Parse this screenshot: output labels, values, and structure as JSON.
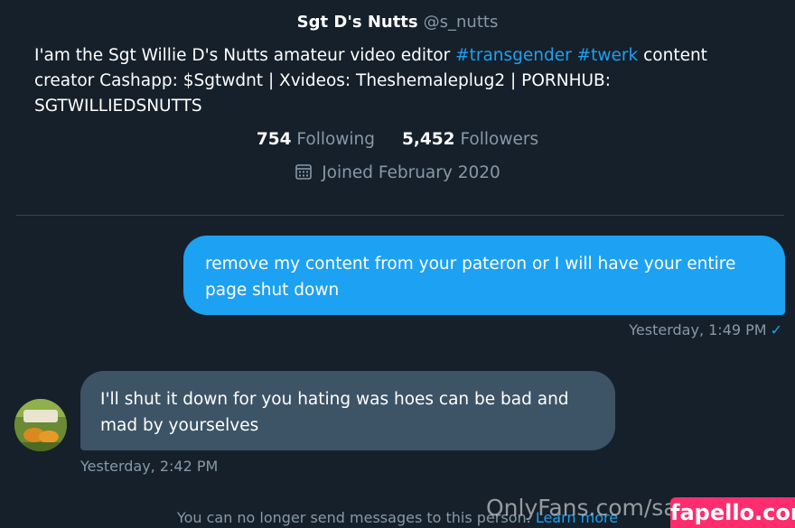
{
  "profile": {
    "name": "Sgt D's Nutts",
    "handle": "@s_nutts",
    "bio_part1": "I'am the Sgt Willie D's Nutts amateur video editor ",
    "hashtag1": "#transgender",
    "hashtag2": "#twerk",
    "bio_part2": " content creator Cashapp: $Sgtwdnt | Xvideos: Theshemaleplug2 | PORNHUB: SGTWILLIEDSNUTTS",
    "following_count": "754",
    "following_label": "Following",
    "followers_count": "5,452",
    "followers_label": "Followers",
    "joined": "Joined February 2020",
    "joined_icon": "calendar-icon"
  },
  "messages": [
    {
      "direction": "outgoing",
      "text": "remove my content from your pateron or I will have your entire page shut down",
      "timestamp": "Yesterday, 1:49 PM",
      "status": "✓"
    },
    {
      "direction": "incoming",
      "text": "I'll shut it down for you hating was hoes can be bad and mad by yourselves",
      "timestamp": "Yesterday, 2:42 PM"
    }
  ],
  "notice": {
    "text": "You can no longer send messages to this person. ",
    "link": "Learn more"
  },
  "watermarks": {
    "onlyfans": "OnlyFans.com/sassy...",
    "fapello": "fapello.com"
  },
  "colors": {
    "background": "#15202b",
    "accent": "#1da1f2",
    "incoming_bubble": "#3d5466",
    "muted_text": "#8899a6",
    "fapello_badge": "#ff2d6e"
  }
}
